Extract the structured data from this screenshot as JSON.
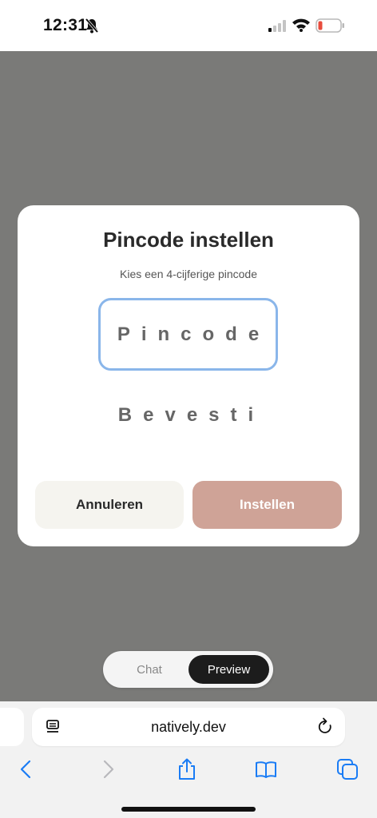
{
  "status": {
    "time": "12:31"
  },
  "dialog": {
    "title": "Pincode instellen",
    "subtitle": "Kies een 4-cijferige pincode",
    "pin_placeholder": "Pincode",
    "confirm_placeholder": "Bevesti",
    "cancel_label": "Annuleren",
    "submit_label": "Instellen"
  },
  "toggle": {
    "chat_label": "Chat",
    "preview_label": "Preview",
    "active": "Preview"
  },
  "browser": {
    "url": "natively.dev"
  },
  "colors": {
    "overlay": "#7a7a78",
    "pin_border": "#8ab6ea",
    "submit_bg": "#cfa397",
    "cancel_bg": "#f5f4ef",
    "ios_blue": "#1a7cf5"
  },
  "icons": [
    "bell-slash-icon",
    "signal-icon",
    "wifi-icon",
    "battery-icon",
    "tab-overview-icon",
    "reload-icon",
    "back-icon",
    "forward-icon",
    "share-icon",
    "bookmarks-icon",
    "tabs-icon"
  ]
}
